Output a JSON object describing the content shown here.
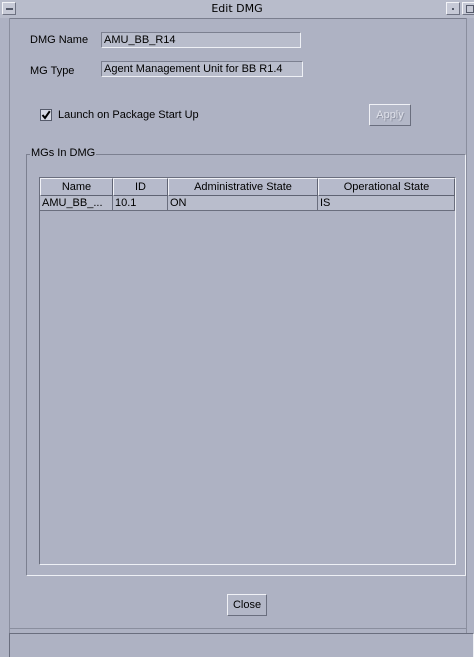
{
  "window": {
    "title": "Edit DMG"
  },
  "form": {
    "dmg_name_label": "DMG Name",
    "dmg_name_value": "AMU_BB_R14",
    "mg_type_label": "MG Type",
    "mg_type_value": "Agent Management Unit for BB R1.4",
    "launch_label": "Launch on Package Start Up",
    "launch_checked": true,
    "apply_label": "Apply"
  },
  "group": {
    "title": "MGs In DMG",
    "columns": [
      "Name",
      "ID",
      "Administrative State",
      "Operational State"
    ],
    "rows": [
      {
        "name": "AMU_BB_...",
        "id": "10.1",
        "admin_state": "ON",
        "oper_state": "IS"
      }
    ]
  },
  "footer": {
    "close_label": "Close",
    "status": ""
  }
}
